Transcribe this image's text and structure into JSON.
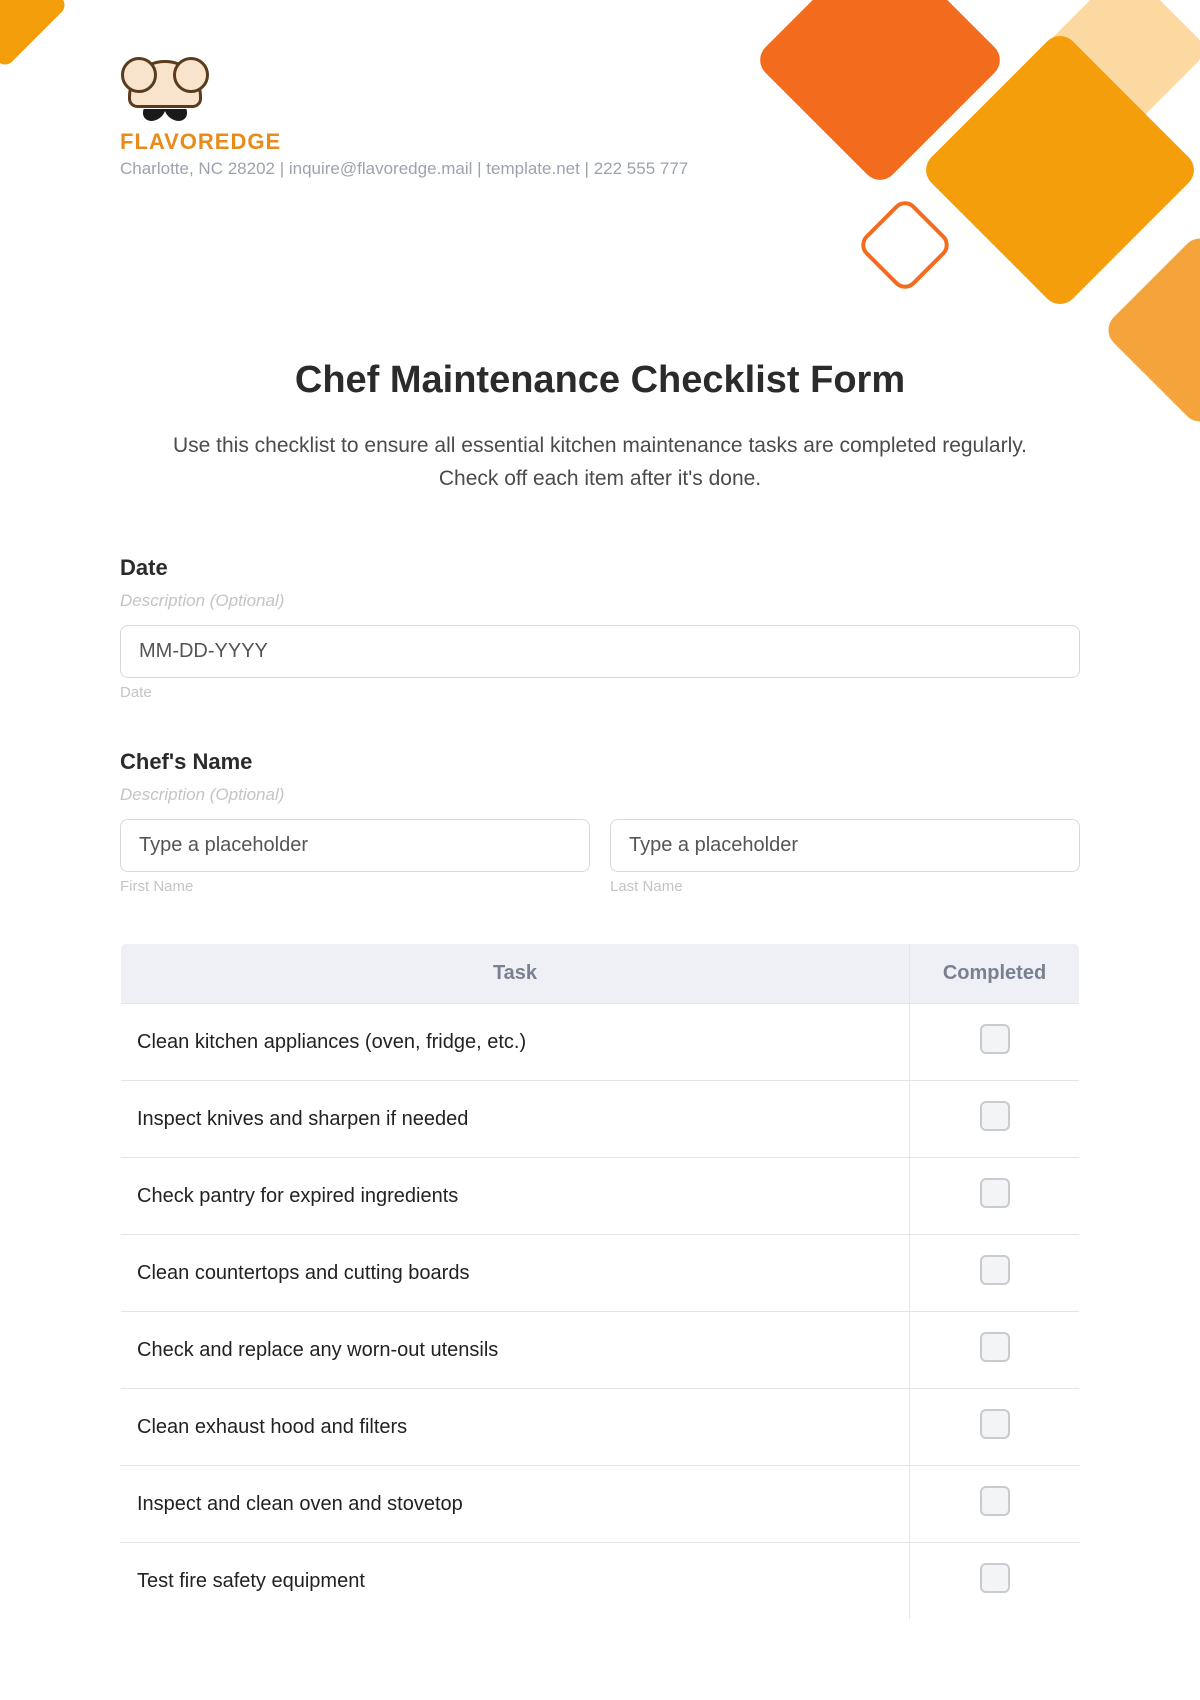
{
  "brand": {
    "name": "FLAVOREDGE",
    "contact": "Charlotte, NC 28202 | inquire@flavoredge.mail | template.net | 222 555 777"
  },
  "form": {
    "title": "Chef Maintenance Checklist Form",
    "intro": "Use this checklist to ensure all essential kitchen maintenance tasks are completed regularly. Check off each item after it's done."
  },
  "fields": {
    "date": {
      "label": "Date",
      "description": "Description (Optional)",
      "placeholder": "MM-DD-YYYY",
      "caption": "Date"
    },
    "chef_name": {
      "label": "Chef's Name",
      "description": "Description (Optional)",
      "first_placeholder": "Type a placeholder",
      "last_placeholder": "Type a placeholder",
      "first_caption": "First Name",
      "last_caption": "Last Name"
    }
  },
  "table": {
    "headers": {
      "task": "Task",
      "completed": "Completed"
    },
    "rows": [
      {
        "task": "Clean kitchen appliances (oven, fridge, etc.)"
      },
      {
        "task": "Inspect knives and sharpen if needed"
      },
      {
        "task": "Check pantry for expired ingredients"
      },
      {
        "task": "Clean countertops and cutting boards"
      },
      {
        "task": "Check and replace any worn-out utensils"
      },
      {
        "task": "Clean exhaust hood and filters"
      },
      {
        "task": "Inspect and clean oven and stovetop"
      },
      {
        "task": "Test fire safety equipment"
      }
    ]
  }
}
